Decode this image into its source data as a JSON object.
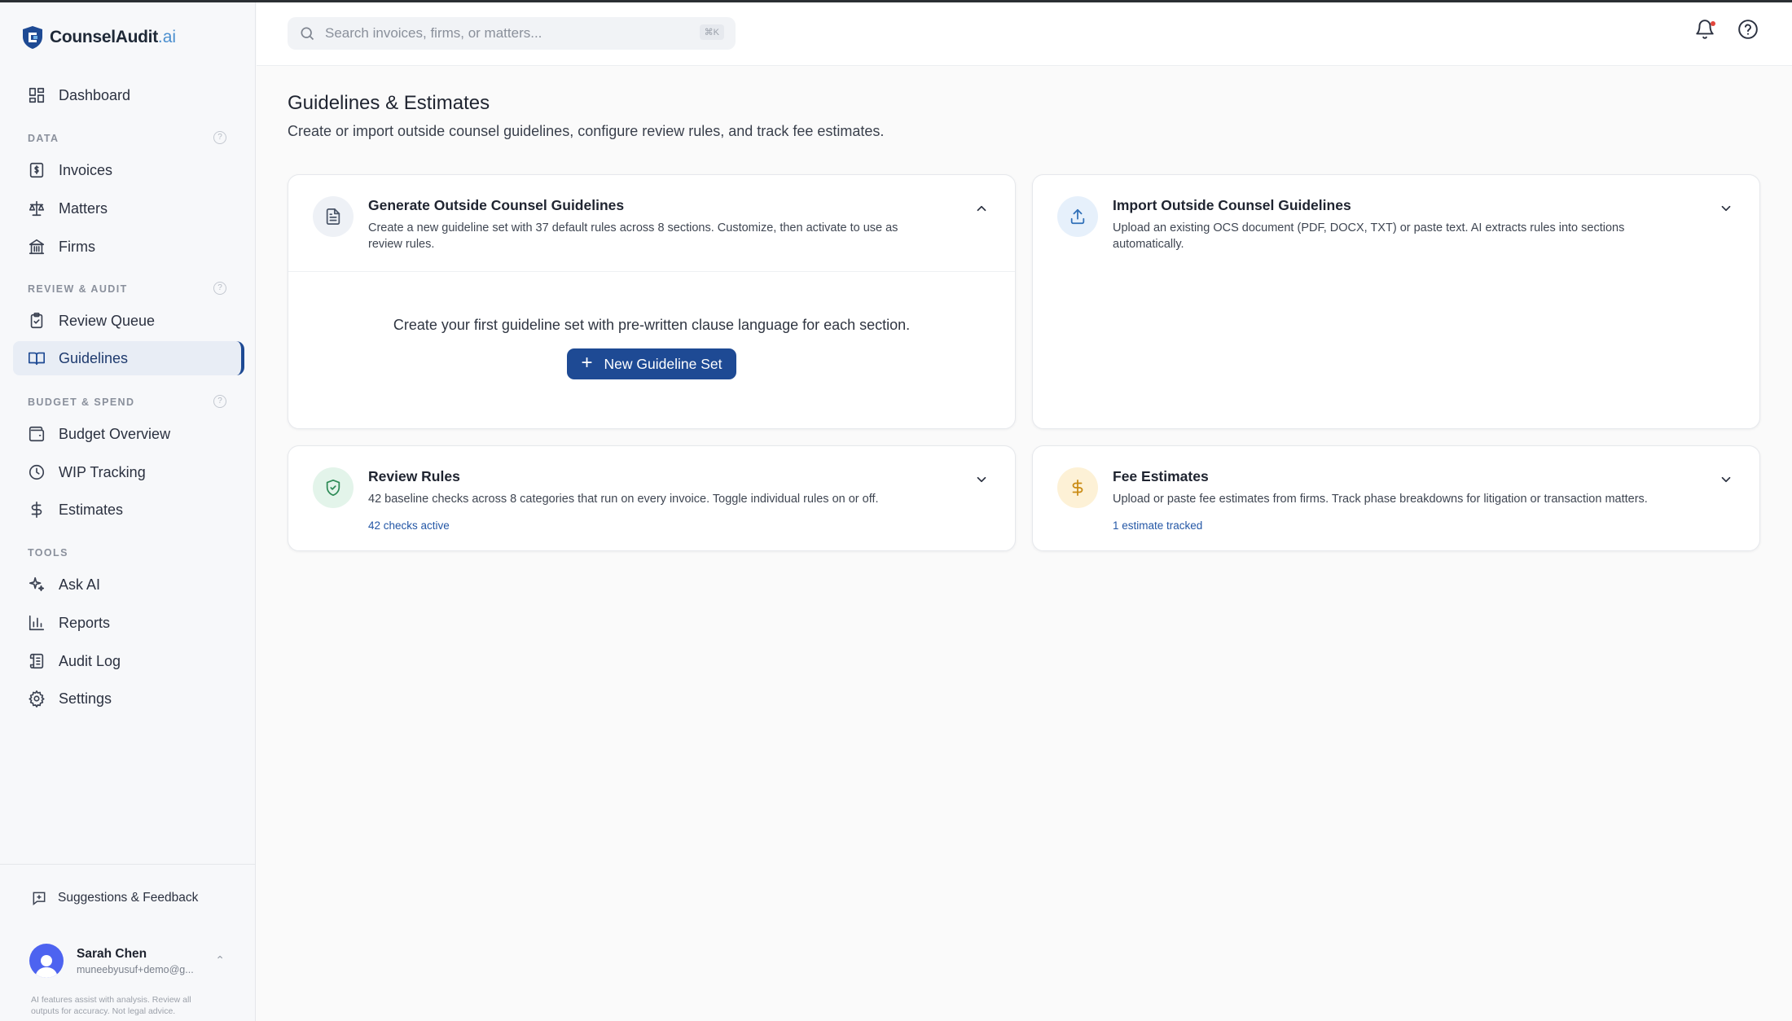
{
  "brand": {
    "name": "CounselAudit",
    "suffix": ".ai"
  },
  "sidebar": {
    "dashboard": "Dashboard",
    "sections": {
      "data": "DATA",
      "review": "REVIEW & AUDIT",
      "budget": "BUDGET & SPEND",
      "tools": "TOOLS"
    },
    "help_glyph": "?",
    "items": {
      "invoices": "Invoices",
      "matters": "Matters",
      "firms": "Firms",
      "review_queue": "Review Queue",
      "guidelines": "Guidelines",
      "budget_overview": "Budget Overview",
      "wip_tracking": "WIP Tracking",
      "estimates": "Estimates",
      "ask_ai": "Ask AI",
      "reports": "Reports",
      "audit_log": "Audit Log",
      "settings": "Settings"
    },
    "active_item": "guidelines",
    "feedback": "Suggestions & Feedback",
    "user": {
      "name": "Sarah Chen",
      "email": "muneebyusuf+demo@g..."
    },
    "disclaimer": "AI features assist with analysis. Review all outputs for accuracy. Not legal advice."
  },
  "search": {
    "placeholder": "Search invoices, firms, or matters...",
    "shortcut": "⌘K"
  },
  "page": {
    "title": "Guidelines & Estimates",
    "subtitle": "Create or import outside counsel guidelines, configure review rules, and track fee estimates."
  },
  "cards": {
    "generate": {
      "title": "Generate Outside Counsel Guidelines",
      "description": "Create a new guideline set with 37 default rules across 8 sections. Customize, then activate to use as review rules.",
      "expanded": true,
      "empty_text": "Create your first guideline set with pre-written clause language for each section.",
      "button": "New Guideline Set"
    },
    "import": {
      "title": "Import Outside Counsel Guidelines",
      "description": "Upload an existing OCS document (PDF, DOCX, TXT) or paste text. AI extracts rules into sections automatically."
    },
    "rules": {
      "title": "Review Rules",
      "description": "42 baseline checks across 8 categories that run on every invoice. Toggle individual rules on or off.",
      "link": "42 checks active"
    },
    "fees": {
      "title": "Fee Estimates",
      "description": "Upload or paste fee estimates from firms. Track phase breakdowns for litigation or transaction matters.",
      "link": "1 estimate tracked"
    }
  },
  "colors": {
    "accent": "#1e4a94",
    "link": "#2457a6",
    "generate_icon_bg": "#eef1f6",
    "import_icon_bg": "#e6f0fb",
    "rules_icon_bg": "#e3f4ea",
    "fees_icon_bg": "#fdf1d6"
  }
}
